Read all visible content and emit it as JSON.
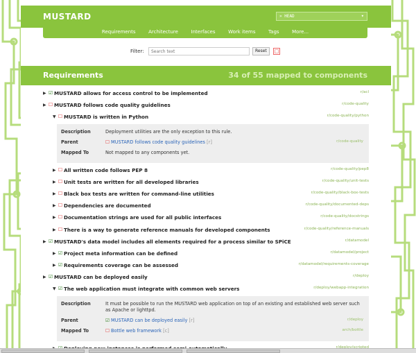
{
  "app": {
    "brand": "MUSTARD",
    "project": "» HEAD",
    "project_arrow": "▾"
  },
  "nav": [
    "Requirements",
    "Architecture",
    "Interfaces",
    "Work items",
    "Tags",
    "More..."
  ],
  "filter": {
    "label": "Filter:",
    "placeholder": "Search text",
    "reset": "Reset",
    "clear": "□"
  },
  "section": {
    "title": "Requirements",
    "count": "34 of 55 mapped to components"
  },
  "rows": [
    {
      "level": 0,
      "toggle": "▶",
      "ok": true,
      "text": "MUSTARD allows for access control to be implemented",
      "path": "r/acl"
    },
    {
      "level": 0,
      "toggle": "▶",
      "ok": false,
      "text": "MUSTARD follows code quality guidelines",
      "path": "r/code-quality"
    },
    {
      "level": 1,
      "toggle": "▼",
      "ok": false,
      "text": "MUSTARD is written in Python",
      "path": "r/code-quality/python"
    }
  ],
  "detail1": {
    "description_label": "Description",
    "description": "Deployment utilities are the only exception to this rule.",
    "parent_label": "Parent",
    "parent_icon": "☐",
    "parent": "MUSTARD follows code quality guidelines",
    "parent_r": "[r]",
    "parent_path": "r/code-quality",
    "mapped_label": "Mapped To",
    "mapped": "Not mapped to any components yet."
  },
  "rows2": [
    {
      "level": 1,
      "toggle": "▶",
      "ok": false,
      "text": "All written code follows PEP 8",
      "path": "r/code-quality/pep8"
    },
    {
      "level": 1,
      "toggle": "▶",
      "ok": false,
      "text": "Unit tests are written for all developed libraries",
      "path": "r/code-quality/unit-tests"
    },
    {
      "level": 1,
      "toggle": "▶",
      "ok": false,
      "text": "Black box tests are written for command-line utilities",
      "path": "r/code-quality/black-box-tests"
    },
    {
      "level": 1,
      "toggle": "▶",
      "ok": false,
      "text": "Dependencies are documented",
      "path": "r/code-quality/documented-deps"
    },
    {
      "level": 1,
      "toggle": "▶",
      "ok": false,
      "text": "Documentation strings are used for all public interfaces",
      "path": "r/code-quality/docstrings"
    },
    {
      "level": 1,
      "toggle": "▶",
      "ok": false,
      "text": "There is a way to generate reference manuals for developed components",
      "path": "r/code-quality/reference-manuals"
    },
    {
      "level": 0,
      "toggle": "▶",
      "ok": true,
      "text": "MUSTARD's data model includes all elements required for a process similar to SPiCE",
      "path": "r/datamodel"
    },
    {
      "level": 1,
      "toggle": "▶",
      "ok": true,
      "text": "Project meta information can be defined",
      "path": "r/datamodel/project"
    },
    {
      "level": 1,
      "toggle": "▶",
      "ok": true,
      "text": "Requirements coverage can be assessed",
      "path": "r/datamodel/requirements-coverage"
    },
    {
      "level": 0,
      "toggle": "▶",
      "ok": true,
      "text": "MUSTARD can be deployed easily",
      "path": "r/deploy"
    },
    {
      "level": 1,
      "toggle": "▼",
      "ok": true,
      "text": "The web application must integrate with common web servers",
      "path": "r/deploy/webapp-integration"
    }
  ],
  "detail2": {
    "description_label": "Description",
    "description": "It must be possible to run the MUSTARD web application on top of an existing and established web server such as Apache or lighttpd.",
    "parent_label": "Parent",
    "parent_icon": "☑",
    "parent": "MUSTARD can be deployed easily",
    "parent_r": "[r]",
    "parent_path": "r/deploy",
    "mapped_label": "Mapped To",
    "mapped_icon": "☐",
    "mapped": "Bottle web framework",
    "mapped_r": "[c]",
    "mapped_path": "arch/bottle"
  },
  "rows3": [
    {
      "level": 1,
      "toggle": "▶",
      "ok": true,
      "text": "Deploying new instances is performed semi-automatically",
      "path": "r/deploy/scripted"
    }
  ],
  "icons": {
    "checked": "☑",
    "unchecked": "☐"
  },
  "colors": {
    "accent": "#8ac43d",
    "ok": "#2e7d1f",
    "missing": "#dd3333",
    "link": "#2a64b8"
  }
}
